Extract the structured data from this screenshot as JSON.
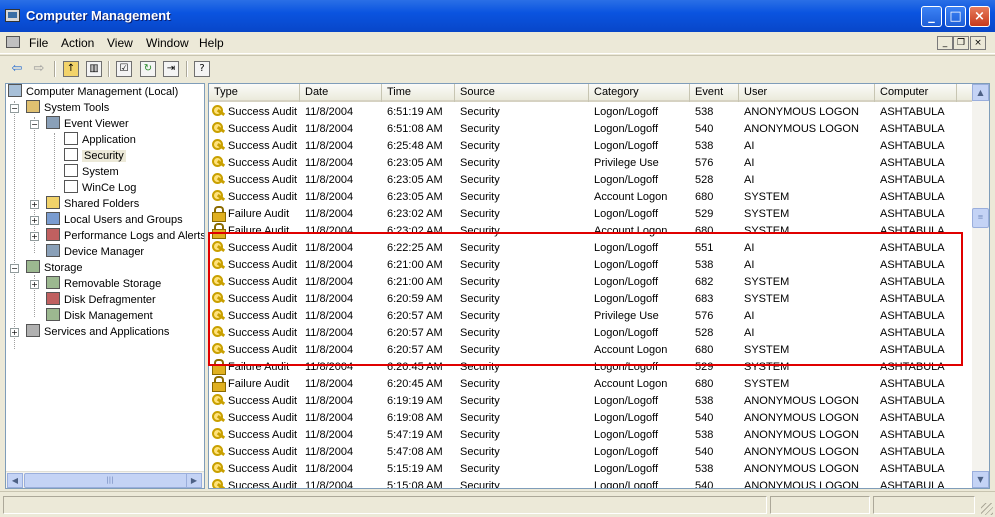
{
  "window": {
    "title": "Computer Management"
  },
  "menu": [
    "File",
    "Action",
    "View",
    "Window",
    "Help"
  ],
  "tree": [
    {
      "label": "Computer Management (Local)",
      "icon": "computer-icon"
    },
    {
      "label": "System Tools",
      "icon": "tools-icon"
    },
    {
      "label": "Event Viewer",
      "icon": "event-viewer-icon"
    },
    {
      "label": "Application",
      "icon": "log-icon"
    },
    {
      "label": "Security",
      "icon": "log-icon",
      "selected": true
    },
    {
      "label": "System",
      "icon": "log-icon"
    },
    {
      "label": "WinCe Log",
      "icon": "log-icon"
    },
    {
      "label": "Shared Folders",
      "icon": "folder-icon"
    },
    {
      "label": "Local Users and Groups",
      "icon": "users-icon"
    },
    {
      "label": "Performance Logs and Alerts",
      "icon": "performance-icon"
    },
    {
      "label": "Device Manager",
      "icon": "device-manager-icon"
    },
    {
      "label": "Storage",
      "icon": "storage-icon"
    },
    {
      "label": "Removable Storage",
      "icon": "removable-storage-icon"
    },
    {
      "label": "Disk Defragmenter",
      "icon": "defragmenter-icon"
    },
    {
      "label": "Disk Management",
      "icon": "disk-management-icon"
    },
    {
      "label": "Services and Applications",
      "icon": "services-icon"
    }
  ],
  "columns": [
    "Type",
    "Date",
    "Time",
    "Source",
    "Category",
    "Event",
    "User",
    "Computer"
  ],
  "rows": [
    {
      "type": "Success Audit",
      "date": "11/8/2004",
      "time": "6:51:19 AM",
      "source": "Security",
      "category": "Logon/Logoff",
      "event": "538",
      "user": "ANONYMOUS LOGON",
      "computer": "ASHTABULA"
    },
    {
      "type": "Success Audit",
      "date": "11/8/2004",
      "time": "6:51:08 AM",
      "source": "Security",
      "category": "Logon/Logoff",
      "event": "540",
      "user": "ANONYMOUS LOGON",
      "computer": "ASHTABULA"
    },
    {
      "type": "Success Audit",
      "date": "11/8/2004",
      "time": "6:25:48 AM",
      "source": "Security",
      "category": "Logon/Logoff",
      "event": "538",
      "user": "AI",
      "computer": "ASHTABULA"
    },
    {
      "type": "Success Audit",
      "date": "11/8/2004",
      "time": "6:23:05 AM",
      "source": "Security",
      "category": "Privilege Use",
      "event": "576",
      "user": "AI",
      "computer": "ASHTABULA"
    },
    {
      "type": "Success Audit",
      "date": "11/8/2004",
      "time": "6:23:05 AM",
      "source": "Security",
      "category": "Logon/Logoff",
      "event": "528",
      "user": "AI",
      "computer": "ASHTABULA"
    },
    {
      "type": "Success Audit",
      "date": "11/8/2004",
      "time": "6:23:05 AM",
      "source": "Security",
      "category": "Account Logon",
      "event": "680",
      "user": "SYSTEM",
      "computer": "ASHTABULA"
    },
    {
      "type": "Failure Audit",
      "date": "11/8/2004",
      "time": "6:23:02 AM",
      "source": "Security",
      "category": "Logon/Logoff",
      "event": "529",
      "user": "SYSTEM",
      "computer": "ASHTABULA"
    },
    {
      "type": "Failure Audit",
      "date": "11/8/2004",
      "time": "6:23:02 AM",
      "source": "Security",
      "category": "Account Logon",
      "event": "680",
      "user": "SYSTEM",
      "computer": "ASHTABULA"
    },
    {
      "type": "Success Audit",
      "date": "11/8/2004",
      "time": "6:22:25 AM",
      "source": "Security",
      "category": "Logon/Logoff",
      "event": "551",
      "user": "AI",
      "computer": "ASHTABULA"
    },
    {
      "type": "Success Audit",
      "date": "11/8/2004",
      "time": "6:21:00 AM",
      "source": "Security",
      "category": "Logon/Logoff",
      "event": "538",
      "user": "AI",
      "computer": "ASHTABULA"
    },
    {
      "type": "Success Audit",
      "date": "11/8/2004",
      "time": "6:21:00 AM",
      "source": "Security",
      "category": "Logon/Logoff",
      "event": "682",
      "user": "SYSTEM",
      "computer": "ASHTABULA"
    },
    {
      "type": "Success Audit",
      "date": "11/8/2004",
      "time": "6:20:59 AM",
      "source": "Security",
      "category": "Logon/Logoff",
      "event": "683",
      "user": "SYSTEM",
      "computer": "ASHTABULA"
    },
    {
      "type": "Success Audit",
      "date": "11/8/2004",
      "time": "6:20:57 AM",
      "source": "Security",
      "category": "Privilege Use",
      "event": "576",
      "user": "AI",
      "computer": "ASHTABULA"
    },
    {
      "type": "Success Audit",
      "date": "11/8/2004",
      "time": "6:20:57 AM",
      "source": "Security",
      "category": "Logon/Logoff",
      "event": "528",
      "user": "AI",
      "computer": "ASHTABULA"
    },
    {
      "type": "Success Audit",
      "date": "11/8/2004",
      "time": "6:20:57 AM",
      "source": "Security",
      "category": "Account Logon",
      "event": "680",
      "user": "SYSTEM",
      "computer": "ASHTABULA"
    },
    {
      "type": "Failure Audit",
      "date": "11/8/2004",
      "time": "6:20:45 AM",
      "source": "Security",
      "category": "Logon/Logoff",
      "event": "529",
      "user": "SYSTEM",
      "computer": "ASHTABULA"
    },
    {
      "type": "Failure Audit",
      "date": "11/8/2004",
      "time": "6:20:45 AM",
      "source": "Security",
      "category": "Account Logon",
      "event": "680",
      "user": "SYSTEM",
      "computer": "ASHTABULA"
    },
    {
      "type": "Success Audit",
      "date": "11/8/2004",
      "time": "6:19:19 AM",
      "source": "Security",
      "category": "Logon/Logoff",
      "event": "538",
      "user": "ANONYMOUS LOGON",
      "computer": "ASHTABULA"
    },
    {
      "type": "Success Audit",
      "date": "11/8/2004",
      "time": "6:19:08 AM",
      "source": "Security",
      "category": "Logon/Logoff",
      "event": "540",
      "user": "ANONYMOUS LOGON",
      "computer": "ASHTABULA"
    },
    {
      "type": "Success Audit",
      "date": "11/8/2004",
      "time": "5:47:19 AM",
      "source": "Security",
      "category": "Logon/Logoff",
      "event": "538",
      "user": "ANONYMOUS LOGON",
      "computer": "ASHTABULA"
    },
    {
      "type": "Success Audit",
      "date": "11/8/2004",
      "time": "5:47:08 AM",
      "source": "Security",
      "category": "Logon/Logoff",
      "event": "540",
      "user": "ANONYMOUS LOGON",
      "computer": "ASHTABULA"
    },
    {
      "type": "Success Audit",
      "date": "11/8/2004",
      "time": "5:15:19 AM",
      "source": "Security",
      "category": "Logon/Logoff",
      "event": "538",
      "user": "ANONYMOUS LOGON",
      "computer": "ASHTABULA"
    },
    {
      "type": "Success Audit",
      "date": "11/8/2004",
      "time": "5:15:08 AM",
      "source": "Security",
      "category": "Logon/Logoff",
      "event": "540",
      "user": "ANONYMOUS LOGON",
      "computer": "ASHTABULA"
    }
  ],
  "colors": {
    "titlebar": "#0A54E0",
    "highlight": "#E00000",
    "chrome": "#ECE9D8"
  }
}
